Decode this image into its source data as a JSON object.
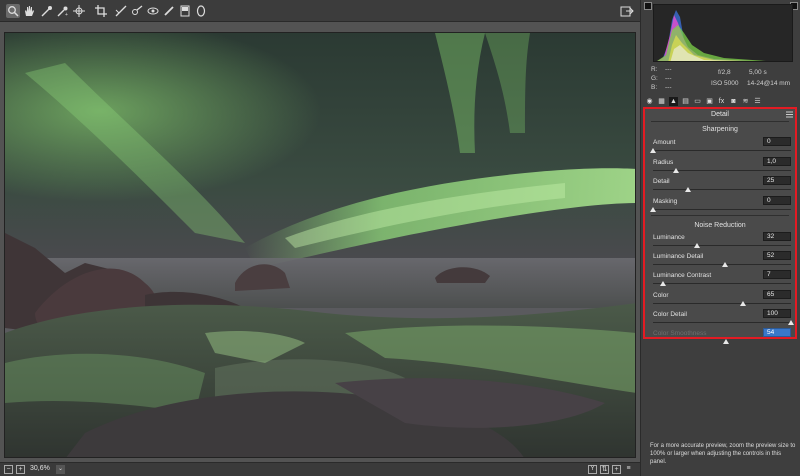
{
  "toolbar": {
    "tools": [
      {
        "icon": "zoom-icon",
        "active": true
      },
      {
        "icon": "hand-icon"
      },
      {
        "icon": "white-balance-icon"
      },
      {
        "icon": "color-sampler-icon"
      },
      {
        "icon": "targeted-adjustment-icon"
      },
      {
        "icon": "crop-icon"
      },
      {
        "icon": "straighten-icon"
      },
      {
        "icon": "spot-removal-icon"
      },
      {
        "icon": "red-eye-icon"
      },
      {
        "icon": "adjustment-brush-icon"
      },
      {
        "icon": "graduated-filter-icon"
      },
      {
        "icon": "radial-filter-icon"
      }
    ],
    "export_icon": "export-icon"
  },
  "status_bar": {
    "zoom_value": "30,6%",
    "buttons": [
      "zoom-out-icon",
      "zoom-in-icon"
    ],
    "right_buttons": [
      "Y",
      "before-after-icon",
      "plus-icon",
      "menu-icon"
    ]
  },
  "camera_info": {
    "r_label": "R:",
    "g_label": "G:",
    "b_label": "B:",
    "r_value": "---",
    "g_value": "---",
    "b_value": "---",
    "aperture": "f/2,8",
    "shutter": "5,00 s",
    "iso": "ISO 5000",
    "lens": "14-24@14 mm"
  },
  "panel_tabs": [
    "basic-icon",
    "tone-curve-icon",
    "detail-icon",
    "hsl-icon",
    "split-toning-icon",
    "lens-icon",
    "effects-icon",
    "calibration-icon",
    "presets-icon",
    "snapshots-icon"
  ],
  "detail": {
    "title": "Detail",
    "sharpening_title": "Sharpening",
    "sharpening": [
      {
        "label": "Amount",
        "value": "0",
        "fraction": 0.0
      },
      {
        "label": "Radius",
        "value": "1,0",
        "fraction": 0.17
      },
      {
        "label": "Detail",
        "value": "25",
        "fraction": 0.25
      },
      {
        "label": "Masking",
        "value": "0",
        "fraction": 0.0
      }
    ],
    "noise_title": "Noise Reduction",
    "noise": [
      {
        "label": "Luminance",
        "value": "32",
        "fraction": 0.32
      },
      {
        "label": "Luminance Detail",
        "value": "52",
        "fraction": 0.52
      },
      {
        "label": "Luminance Contrast",
        "value": "7",
        "fraction": 0.07
      },
      {
        "label": "Color",
        "value": "65",
        "fraction": 0.65
      },
      {
        "label": "Color Detail",
        "value": "100",
        "fraction": 1.0
      },
      {
        "label": "Color Smoothness",
        "value": "54",
        "fraction": 0.54,
        "disabled": true
      }
    ]
  },
  "info_note": "For a more accurate preview, zoom the preview size to 100% or larger when adjusting the controls in this panel.",
  "colors": {
    "highlight_border": "#e31b23",
    "aurora": "#8fd67a",
    "panel_bg": "#3e3e3e"
  }
}
